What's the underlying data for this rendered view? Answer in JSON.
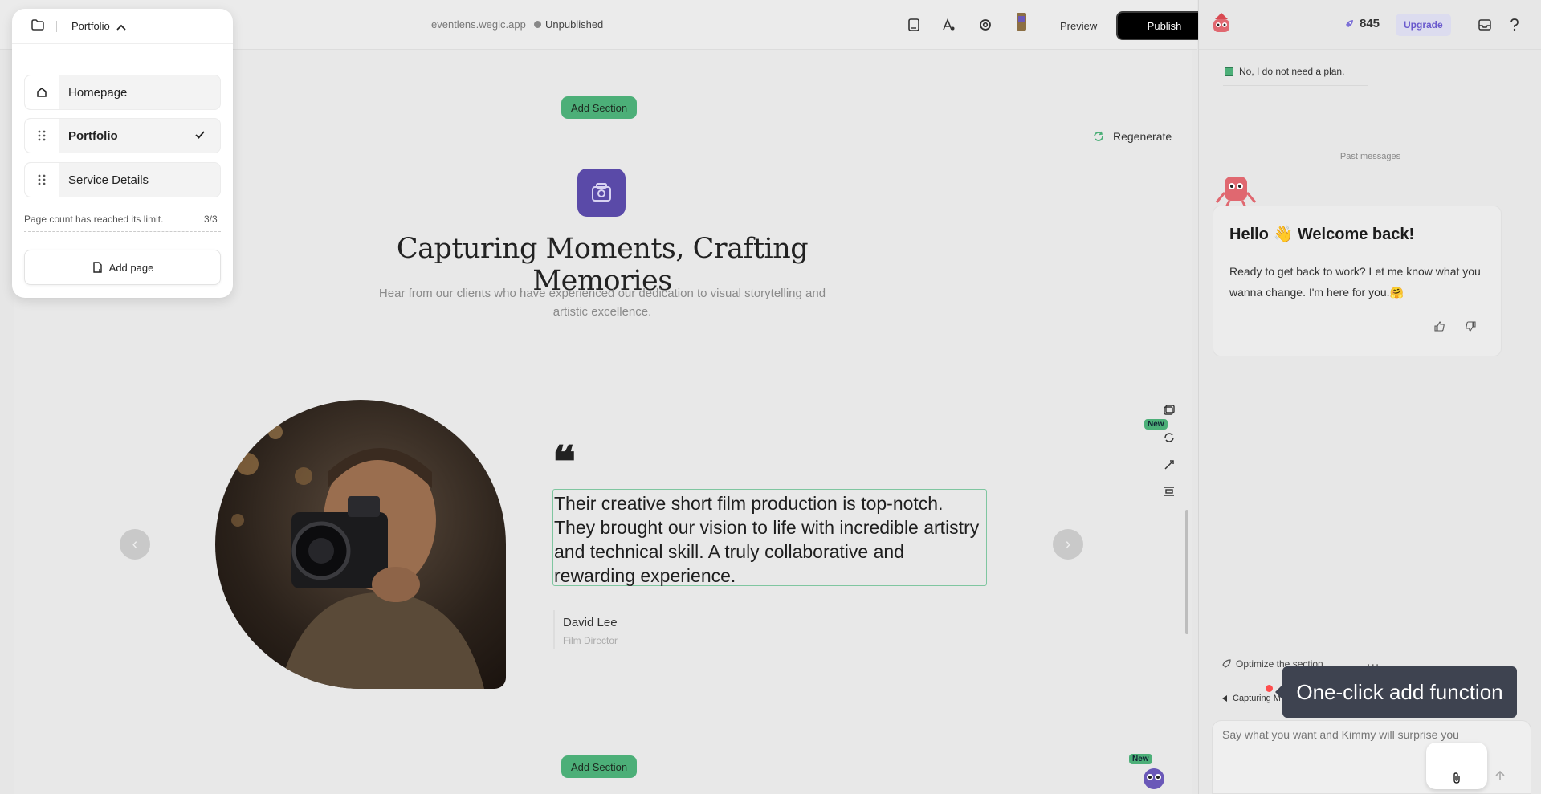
{
  "topbar": {
    "url": "eventlens.wegic.app",
    "status": "Unpublished",
    "preview_label": "Preview",
    "publish_label": "Publish",
    "icons": [
      "page-icon",
      "font-icon",
      "settings-icon",
      "avatar"
    ]
  },
  "pages_panel": {
    "current_page": "Portfolio",
    "pages": [
      {
        "label": "Homepage",
        "icon": "home-icon",
        "active": false
      },
      {
        "label": "Portfolio",
        "icon": "drag-handle-icon",
        "active": true
      },
      {
        "label": "Service Details",
        "icon": "drag-handle-icon",
        "active": false
      }
    ],
    "limit_text": "Page count has reached its limit.",
    "limit_count": "3/3",
    "add_page_label": "Add page"
  },
  "canvas": {
    "add_section_label": "Add Section",
    "regenerate_label": "Regenerate",
    "title": "Capturing Moments, Crafting Memories",
    "subtitle": "Hear from our clients who have experienced our dedication to visual storytelling and artistic excellence.",
    "quote_mark": "❝",
    "quote": "Their creative short film production is top-notch. They brought our vision to life with incredible artistry and technical skill. A truly collaborative and rewarding experience.",
    "author_name": "David Lee",
    "author_role": "Film Director",
    "new_tag": "New",
    "prev_arrow": "‹",
    "next_arrow": "›"
  },
  "chat": {
    "credits": "845",
    "upgrade_label": "Upgrade",
    "plan_option": "No, I do not need a plan.",
    "past_messages": "Past messages",
    "welcome_title": "Hello 👋 Welcome back!",
    "welcome_body": "Ready to get back to work? Let me know what you wanna change. I'm here for you.🤗",
    "optimize_label": "Optimize the section",
    "more_label": "...",
    "context_label": "Capturing M",
    "input_placeholder": "Say what you want and Kimmy will surprise you",
    "tooltip": "One-click add function"
  },
  "colors": {
    "accent_green": "#4caf78",
    "brand_purple": "#5a4aa8",
    "publish_bg": "#000000",
    "tooltip_bg": "#3e4350"
  }
}
